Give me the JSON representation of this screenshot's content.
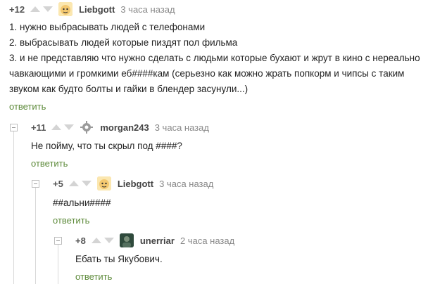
{
  "comments": [
    {
      "rating": "+12",
      "username": "Liebgott",
      "time": "3 часа назад",
      "lines": [
        "1. нужно выбрасывать людей с телефонами",
        "2. выбрасывать людей которые пиздят пол фильма",
        "3. и не представляю что нужно сделать с людьми которые бухают и жрут в кино с нереально",
        "чавкающими и громкими еб####кам (серьезно как можно жрать попкорм и чипсы с таким",
        "звуком как будто болты и гайки в блендер засунули...)"
      ],
      "reply": "ответить",
      "avatar_icon": "cartoon-character-avatar",
      "avatar_color": "#f4c870"
    },
    {
      "rating": "+11",
      "username": "morgan243",
      "time": "3 часа назад",
      "lines": [
        "Не пойму, что ты скрыл под ####?"
      ],
      "reply": "ответить",
      "avatar_icon": "gear-avatar",
      "avatar_color": "#9a9a9a"
    },
    {
      "rating": "+5",
      "username": "Liebgott",
      "time": "3 часа назад",
      "lines": [
        "##альни####"
      ],
      "reply": "ответить",
      "avatar_icon": "cartoon-character-avatar",
      "avatar_color": "#f4c870"
    },
    {
      "rating": "+8",
      "username": "unerriar",
      "time": "2 часа назад",
      "lines": [
        "Ебать ты Якубович."
      ],
      "reply": "ответить",
      "avatar_icon": "photo-avatar",
      "avatar_color": "#3d5a4a"
    }
  ],
  "colors": {
    "reply_link": "#5d8a3a",
    "arrow": "#d4d4d4",
    "time": "#888888"
  }
}
